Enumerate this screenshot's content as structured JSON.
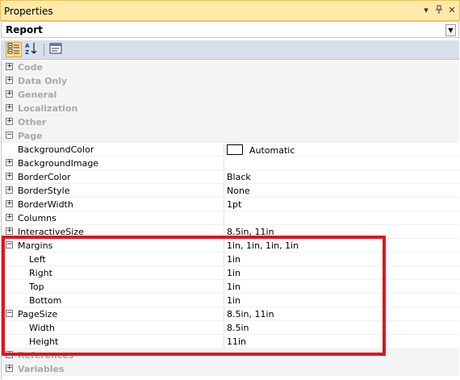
{
  "window": {
    "title": "Properties",
    "controls": [
      "▾",
      "pin-icon",
      "✕"
    ]
  },
  "object_selector": {
    "value": "Report"
  },
  "toolbar": {
    "buttons": [
      "categorized-icon",
      "alphabetical-icon",
      "property-pages-icon"
    ]
  },
  "categories_top": [
    {
      "name": "Code",
      "expanded": false
    },
    {
      "name": "Data Only",
      "expanded": false
    },
    {
      "name": "General",
      "expanded": false
    },
    {
      "name": "Localization",
      "expanded": false
    },
    {
      "name": "Other",
      "expanded": false
    },
    {
      "name": "Page",
      "expanded": true
    }
  ],
  "page_properties": [
    {
      "name": "BackgroundColor",
      "value": "Automatic",
      "expander": false,
      "swatch_color": "#ffffff"
    },
    {
      "name": "BackgroundImage",
      "value": "",
      "expander": true
    },
    {
      "name": "BorderColor",
      "value": "Black",
      "expander": true
    },
    {
      "name": "BorderStyle",
      "value": "None",
      "expander": true
    },
    {
      "name": "BorderWidth",
      "value": "1pt",
      "expander": true
    },
    {
      "name": "Columns",
      "value": "",
      "expander": true
    },
    {
      "name": "InteractiveSize",
      "value": "8.5in, 11in",
      "expander": true
    },
    {
      "name": "Margins",
      "value": "1in, 1in, 1in, 1in",
      "expander": true,
      "expanded": true
    },
    {
      "name": "Left",
      "value": "1in",
      "sub": true
    },
    {
      "name": "Right",
      "value": "1in",
      "sub": true
    },
    {
      "name": "Top",
      "value": "1in",
      "sub": true
    },
    {
      "name": "Bottom",
      "value": "1in",
      "sub": true
    },
    {
      "name": "PageSize",
      "value": "8.5in, 11in",
      "expander": true,
      "expanded": true
    },
    {
      "name": "Width",
      "value": "8.5in",
      "sub": true
    },
    {
      "name": "Height",
      "value": "11in",
      "sub": true
    }
  ],
  "categories_bottom": [
    {
      "name": "References",
      "expanded": false
    },
    {
      "name": "Variables",
      "expanded": false
    }
  ],
  "colors": {
    "highlight_box": "#e0141c",
    "titlebar": "#ffe9a8",
    "toolbar": "#d8dfec"
  }
}
